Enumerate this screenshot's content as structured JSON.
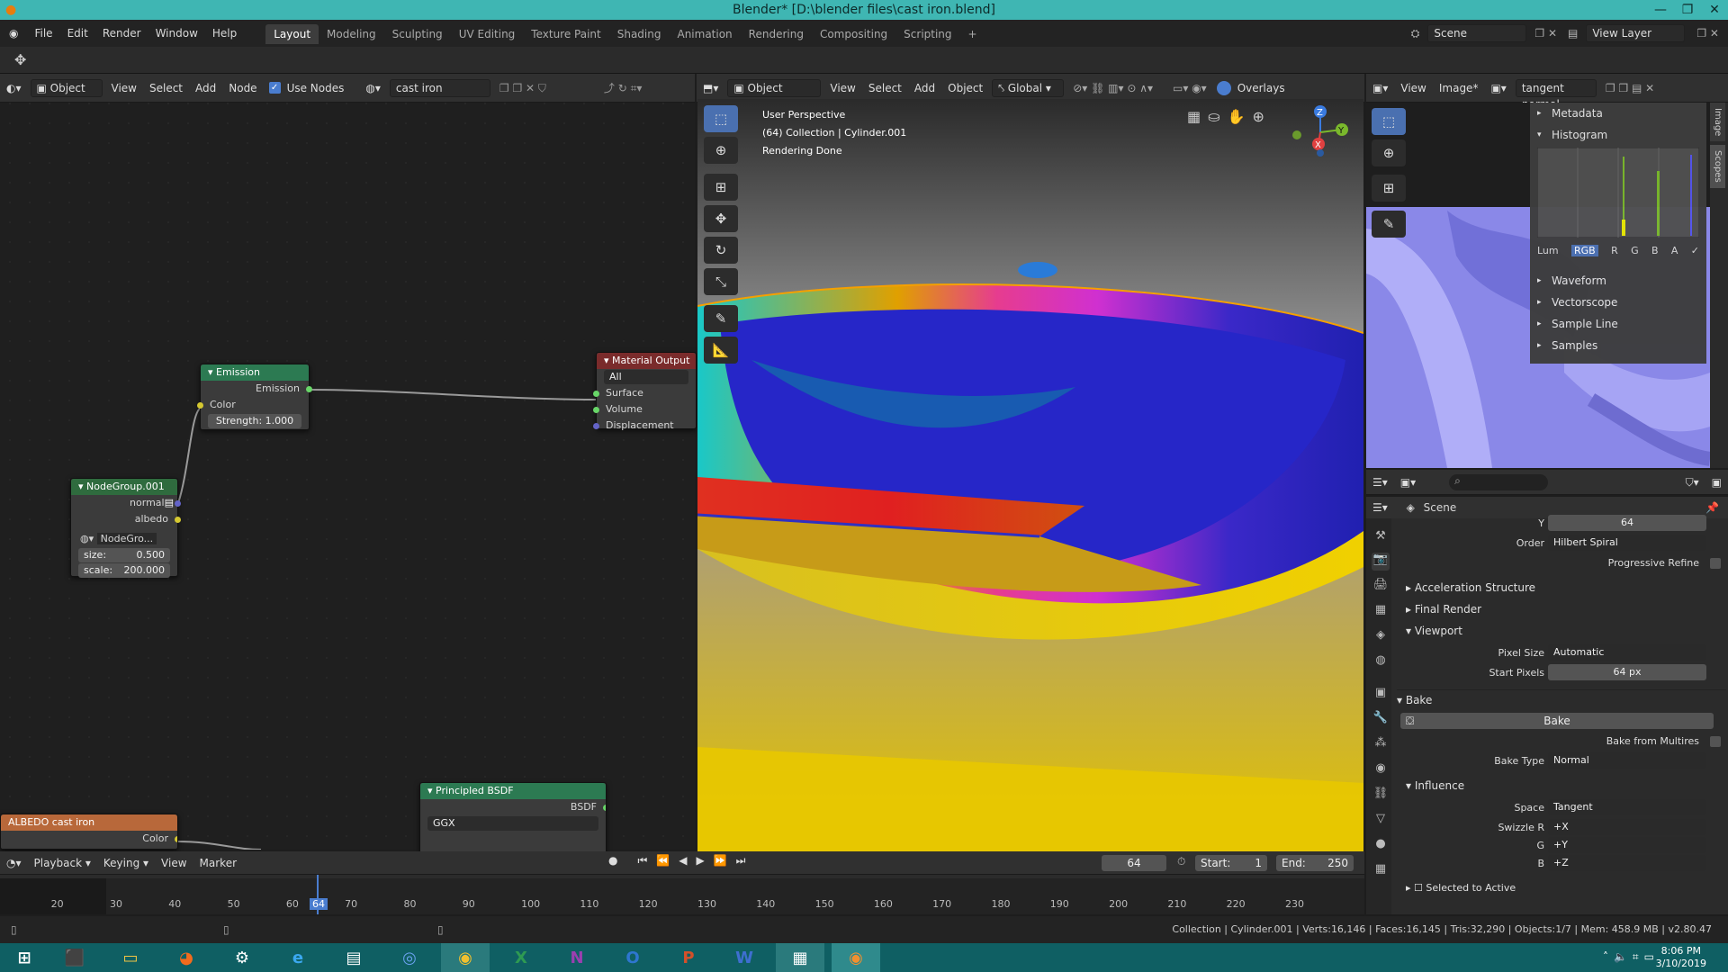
{
  "window": {
    "title": "Blender* [D:\\blender files\\cast iron.blend]"
  },
  "menu": [
    "File",
    "Edit",
    "Render",
    "Window",
    "Help"
  ],
  "workspaces": [
    "Layout",
    "Modeling",
    "Sculpting",
    "UV Editing",
    "Texture Paint",
    "Shading",
    "Animation",
    "Rendering",
    "Compositing",
    "Scripting",
    "+"
  ],
  "scene": {
    "scene_name": "Scene",
    "view_layer": "View Layer"
  },
  "node_editor": {
    "header": {
      "type": "Object",
      "menus": [
        "View",
        "Select",
        "Add",
        "Node"
      ],
      "use_nodes": "Use Nodes",
      "material": "cast iron"
    },
    "nodes": {
      "emission": {
        "title": "Emission",
        "out": "Emission",
        "color": "Color",
        "strength": "Strength: 1.000"
      },
      "material_output": {
        "title": "Material Output",
        "target": "All",
        "surface": "Surface",
        "volume": "Volume",
        "displacement": "Displacement"
      },
      "nodegroup": {
        "title": "NodeGroup.001",
        "normal": "normal",
        "albedo": "albedo",
        "group": "NodeGro...",
        "size_label": "size:",
        "size": "0.500",
        "scale_label": "scale:",
        "scale": "200.000"
      },
      "principled": {
        "title": "Principled BSDF",
        "out": "BSDF",
        "dist": "GGX"
      },
      "albedo": {
        "title": "ALBEDO cast iron",
        "color": "Color"
      }
    }
  },
  "viewport": {
    "mode": "Object Mode",
    "menus": [
      "View",
      "Select",
      "Add",
      "Object"
    ],
    "orientation": "Global",
    "overlays": "Overlays",
    "info": [
      "User Perspective",
      "(64) Collection | Cylinder.001",
      "Rendering Done"
    ],
    "gizmo": {
      "x": "X",
      "y": "Y",
      "z": "Z"
    }
  },
  "image_editor": {
    "menus": [
      "View",
      "Image*"
    ],
    "image": "tangent normal",
    "tabs": [
      "Image",
      "Scopes"
    ],
    "scopes": {
      "metadata": "Metadata",
      "histogram": "Histogram",
      "channels": [
        "Lum",
        "RGB",
        "R",
        "G",
        "B",
        "A"
      ],
      "waveform": "Waveform",
      "vectorscope": "Vectorscope",
      "sample_line": "Sample Line",
      "samples": "Samples"
    }
  },
  "properties": {
    "context": "Scene",
    "rows": {
      "y_label": "Y",
      "y": "64",
      "order_label": "Order",
      "order": "Hilbert Spiral",
      "progressive": "Progressive Refine",
      "accel": "Acceleration Structure",
      "final": "Final Render",
      "viewport": "Viewport",
      "pixel_size_label": "Pixel Size",
      "pixel_size": "Automatic",
      "start_pixels_label": "Start Pixels",
      "start_pixels": "64 px",
      "bake_section": "Bake",
      "bake_btn": "Bake",
      "multires": "Bake from Multires",
      "bake_type_label": "Bake Type",
      "bake_type": "Normal",
      "influence": "Influence",
      "space_label": "Space",
      "space": "Tangent",
      "swz_r_label": "Swizzle R",
      "swz_r": "+X",
      "g_label": "G",
      "g": "+Y",
      "b_label": "B",
      "b": "+Z",
      "selected": "Selected to Active"
    }
  },
  "timeline": {
    "menus": [
      "Playback",
      "Keying",
      "View",
      "Marker"
    ],
    "frame": "64",
    "start_label": "Start:",
    "start": "1",
    "end_label": "End:",
    "end": "250",
    "ticks": [
      "20",
      "30",
      "40",
      "50",
      "60",
      "64",
      "70",
      "80",
      "90",
      "100",
      "110",
      "120",
      "130",
      "140",
      "150",
      "160",
      "170",
      "180",
      "190",
      "200",
      "210",
      "220",
      "230"
    ]
  },
  "status": {
    "text": "Collection | Cylinder.001 | Verts:16,146 | Faces:16,145 | Tris:32,290 | Objects:1/7 | Mem: 458.9 MB | v2.80.47"
  },
  "taskbar": {
    "time": "8:06 PM",
    "date": "3/10/2019",
    "apps": [
      "windows-icon",
      "store-icon",
      "explorer-icon",
      "firefox-icon",
      "steam-icon",
      "ie-icon",
      "files-icon",
      "chromium-icon",
      "chrome-icon",
      "excel-icon",
      "onenote-icon",
      "outlook-icon",
      "powerpoint-icon",
      "word-icon",
      "photos-icon",
      "blender-icon"
    ]
  }
}
